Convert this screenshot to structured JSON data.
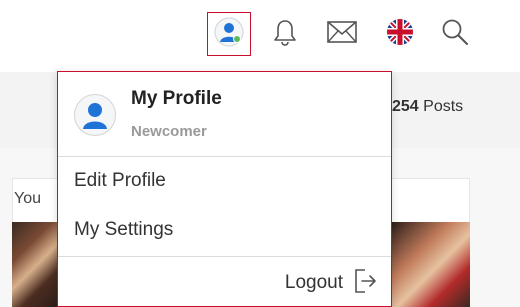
{
  "header": {
    "icons": [
      "user-avatar-icon",
      "bell-icon",
      "envelope-icon",
      "uk-flag-icon",
      "search-icon"
    ]
  },
  "stats": {
    "posts_count": "254",
    "posts_label": "Posts"
  },
  "content": {
    "card_text": "You"
  },
  "dropdown": {
    "name": "My Profile",
    "role": "Newcomer",
    "items": [
      {
        "label": "Edit Profile"
      },
      {
        "label": "My Settings"
      }
    ],
    "logout_label": "Logout"
  },
  "colors": {
    "accent": "#c8102e",
    "avatar_blue": "#1f73d6",
    "online_green": "#5cb85c"
  }
}
